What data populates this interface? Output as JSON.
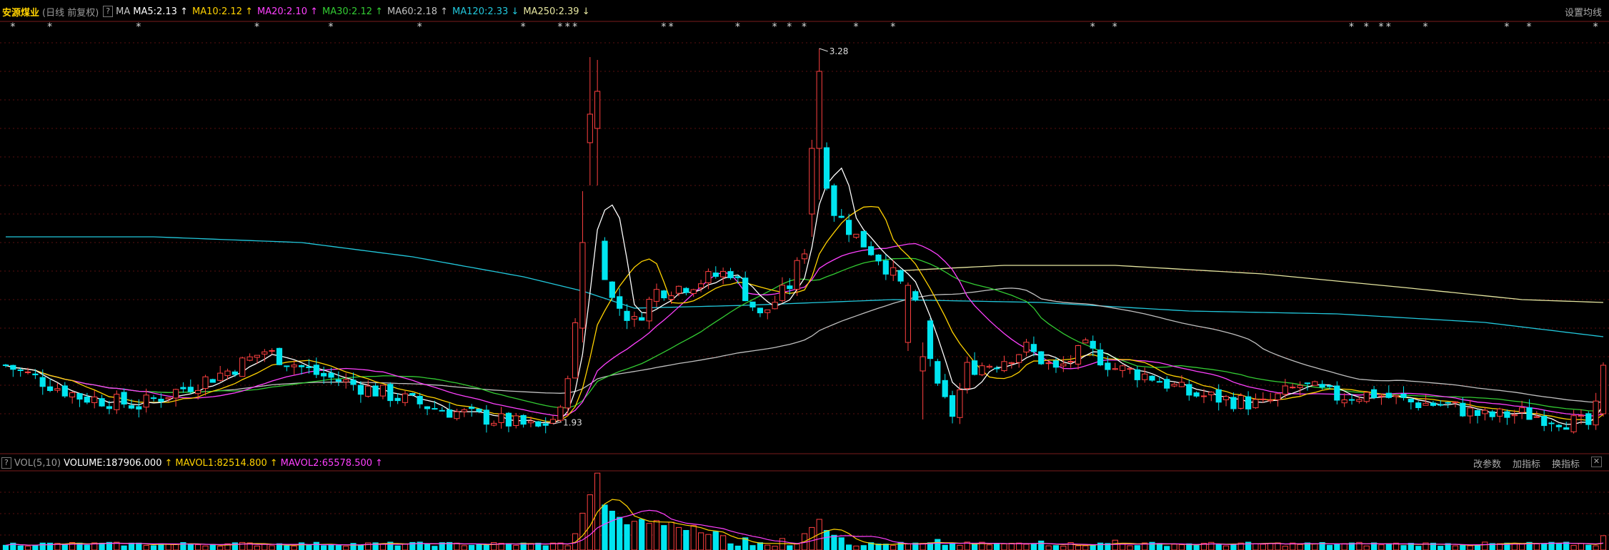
{
  "header": {
    "stock_name": "安源煤业",
    "period": "(日线 前复权)",
    "help": "?",
    "ma_label": "MA",
    "ma_items": [
      {
        "label": "MA5:2.13",
        "arrow": "↑",
        "color": "#ffffff"
      },
      {
        "label": "MA10:2.12",
        "arrow": "↑",
        "color": "#ffd200"
      },
      {
        "label": "MA20:2.10",
        "arrow": "↑",
        "color": "#ff40ff"
      },
      {
        "label": "MA30:2.12",
        "arrow": "↑",
        "color": "#33cc33"
      },
      {
        "label": "MA60:2.18",
        "arrow": "↑",
        "color": "#c0c0c0"
      },
      {
        "label": "MA120:2.33",
        "arrow": "↓",
        "color": "#22c8dc"
      },
      {
        "label": "MA250:2.39",
        "arrow": "↓",
        "color": "#e6e6a0"
      }
    ],
    "settings": "设置均线"
  },
  "volume_header": {
    "help": "?",
    "indicator": "VOL(5,10)",
    "volume": "VOLUME:187906.000",
    "volume_arrow": "↑",
    "mavol1": "MAVOL1:82514.800",
    "mavol1_arrow": "↑",
    "mavol2": "MAVOL2:65578.500",
    "mavol2_arrow": "↑",
    "tools": [
      "改参数",
      "加指标",
      "换指标"
    ],
    "close": "✕"
  },
  "colors": {
    "up": "#ff4040",
    "down": "#00e5f0",
    "grid": "#5a1010",
    "ma5": "#ffffff",
    "ma10": "#ffd200",
    "ma20": "#ff40ff",
    "ma30": "#33cc33",
    "ma60": "#c0c0c0",
    "ma120": "#22c8dc",
    "ma250": "#e6e6a0"
  },
  "chart_data": {
    "type": "candlestick",
    "price_range": [
      1.88,
      3.35
    ],
    "annotations": [
      {
        "label": "3.28",
        "type": "high",
        "index": 110
      },
      {
        "label": "1.93",
        "type": "low",
        "index": 74
      }
    ],
    "kline_anchors": [
      [
        0,
        2.17
      ],
      [
        10,
        2.06
      ],
      [
        18,
        2.03
      ],
      [
        25,
        2.1
      ],
      [
        30,
        2.15
      ],
      [
        35,
        2.22
      ],
      [
        42,
        2.14
      ],
      [
        50,
        2.08
      ],
      [
        58,
        2.02
      ],
      [
        66,
        1.98
      ],
      [
        72,
        1.95
      ],
      [
        75,
        2.0
      ],
      [
        78,
        2.45
      ],
      [
        80,
        2.6
      ],
      [
        82,
        2.4
      ],
      [
        85,
        2.32
      ],
      [
        88,
        2.43
      ],
      [
        92,
        2.45
      ],
      [
        98,
        2.5
      ],
      [
        102,
        2.34
      ],
      [
        106,
        2.45
      ],
      [
        108,
        2.58
      ],
      [
        110,
        2.93
      ],
      [
        112,
        2.71
      ],
      [
        115,
        2.62
      ],
      [
        118,
        2.55
      ],
      [
        122,
        2.42
      ],
      [
        124,
        2.32
      ],
      [
        126,
        2.08
      ],
      [
        128,
        2.0
      ],
      [
        130,
        2.16
      ],
      [
        134,
        2.18
      ],
      [
        138,
        2.23
      ],
      [
        142,
        2.15
      ],
      [
        146,
        2.23
      ],
      [
        150,
        2.16
      ],
      [
        155,
        2.13
      ],
      [
        160,
        2.07
      ],
      [
        165,
        2.05
      ],
      [
        170,
        2.03
      ],
      [
        175,
        2.1
      ],
      [
        180,
        2.06
      ],
      [
        185,
        2.07
      ],
      [
        190,
        2.04
      ],
      [
        195,
        2.03
      ],
      [
        200,
        1.99
      ],
      [
        205,
        2.0
      ],
      [
        210,
        1.98
      ],
      [
        214,
        1.96
      ],
      [
        216,
        2.07
      ]
    ],
    "spikes": [
      {
        "index": 78,
        "open": 2.3,
        "close": 2.6,
        "high": 2.78,
        "low": 2.25
      },
      {
        "index": 79,
        "open": 2.95,
        "close": 3.05,
        "high": 3.25,
        "low": 2.8
      },
      {
        "index": 80,
        "open": 3.0,
        "close": 3.13,
        "high": 3.24,
        "low": 2.8
      },
      {
        "index": 109,
        "open": 2.7,
        "close": 2.93,
        "high": 2.96,
        "low": 2.62
      },
      {
        "index": 110,
        "open": 2.93,
        "close": 3.2,
        "high": 3.28,
        "low": 2.75
      },
      {
        "index": 122,
        "open": 2.25,
        "close": 2.45,
        "high": 2.46,
        "low": 2.22
      },
      {
        "index": 124,
        "open": 2.15,
        "close": 2.2,
        "high": 2.25,
        "low": 1.98
      },
      {
        "index": 216,
        "open": 2.0,
        "close": 2.17,
        "high": 2.18,
        "low": 1.99
      }
    ],
    "ma120_anchors": [
      [
        0,
        2.62
      ],
      [
        20,
        2.62
      ],
      [
        40,
        2.6
      ],
      [
        55,
        2.55
      ],
      [
        70,
        2.48
      ],
      [
        78,
        2.43
      ],
      [
        85,
        2.37
      ],
      [
        100,
        2.38
      ],
      [
        120,
        2.4
      ],
      [
        140,
        2.39
      ],
      [
        160,
        2.36
      ],
      [
        180,
        2.35
      ],
      [
        200,
        2.32
      ],
      [
        216,
        2.27
      ]
    ],
    "ma250_anchors": [
      [
        120,
        2.5
      ],
      [
        135,
        2.52
      ],
      [
        150,
        2.52
      ],
      [
        170,
        2.49
      ],
      [
        190,
        2.44
      ],
      [
        205,
        2.4
      ],
      [
        216,
        2.39
      ]
    ],
    "volume_range": [
      0,
      190000
    ],
    "volume_base": 13000,
    "volume_spikes": [
      {
        "index": 77,
        "value": 40000
      },
      {
        "index": 78,
        "value": 90000
      },
      {
        "index": 79,
        "value": 135000
      },
      {
        "index": 80,
        "value": 187906
      },
      {
        "index": 81,
        "value": 110000
      },
      {
        "index": 82,
        "value": 95000
      },
      {
        "index": 83,
        "value": 80000
      },
      {
        "index": 84,
        "value": 62000
      },
      {
        "index": 85,
        "value": 70000
      },
      {
        "index": 86,
        "value": 75000
      },
      {
        "index": 87,
        "value": 65000
      },
      {
        "index": 88,
        "value": 72000
      },
      {
        "index": 89,
        "value": 60000
      },
      {
        "index": 90,
        "value": 68000
      },
      {
        "index": 91,
        "value": 55000
      },
      {
        "index": 92,
        "value": 48000
      },
      {
        "index": 93,
        "value": 60000
      },
      {
        "index": 94,
        "value": 42000
      },
      {
        "index": 95,
        "value": 38000
      },
      {
        "index": 96,
        "value": 45000
      },
      {
        "index": 97,
        "value": 35000
      },
      {
        "index": 100,
        "value": 30000
      },
      {
        "index": 105,
        "value": 28000
      },
      {
        "index": 108,
        "value": 40000
      },
      {
        "index": 109,
        "value": 55000
      },
      {
        "index": 110,
        "value": 75000
      },
      {
        "index": 111,
        "value": 48000
      },
      {
        "index": 112,
        "value": 36000
      },
      {
        "index": 113,
        "value": 30000
      },
      {
        "index": 126,
        "value": 26000
      },
      {
        "index": 140,
        "value": 22000
      },
      {
        "index": 150,
        "value": 24000
      },
      {
        "index": 216,
        "value": 35000
      }
    ],
    "markers": [
      1,
      6,
      18,
      34,
      44,
      56,
      70,
      75,
      76,
      77,
      89,
      90,
      99,
      104,
      106,
      108,
      115,
      120,
      147,
      150,
      182,
      184,
      186,
      187,
      192,
      203,
      206,
      215
    ]
  }
}
